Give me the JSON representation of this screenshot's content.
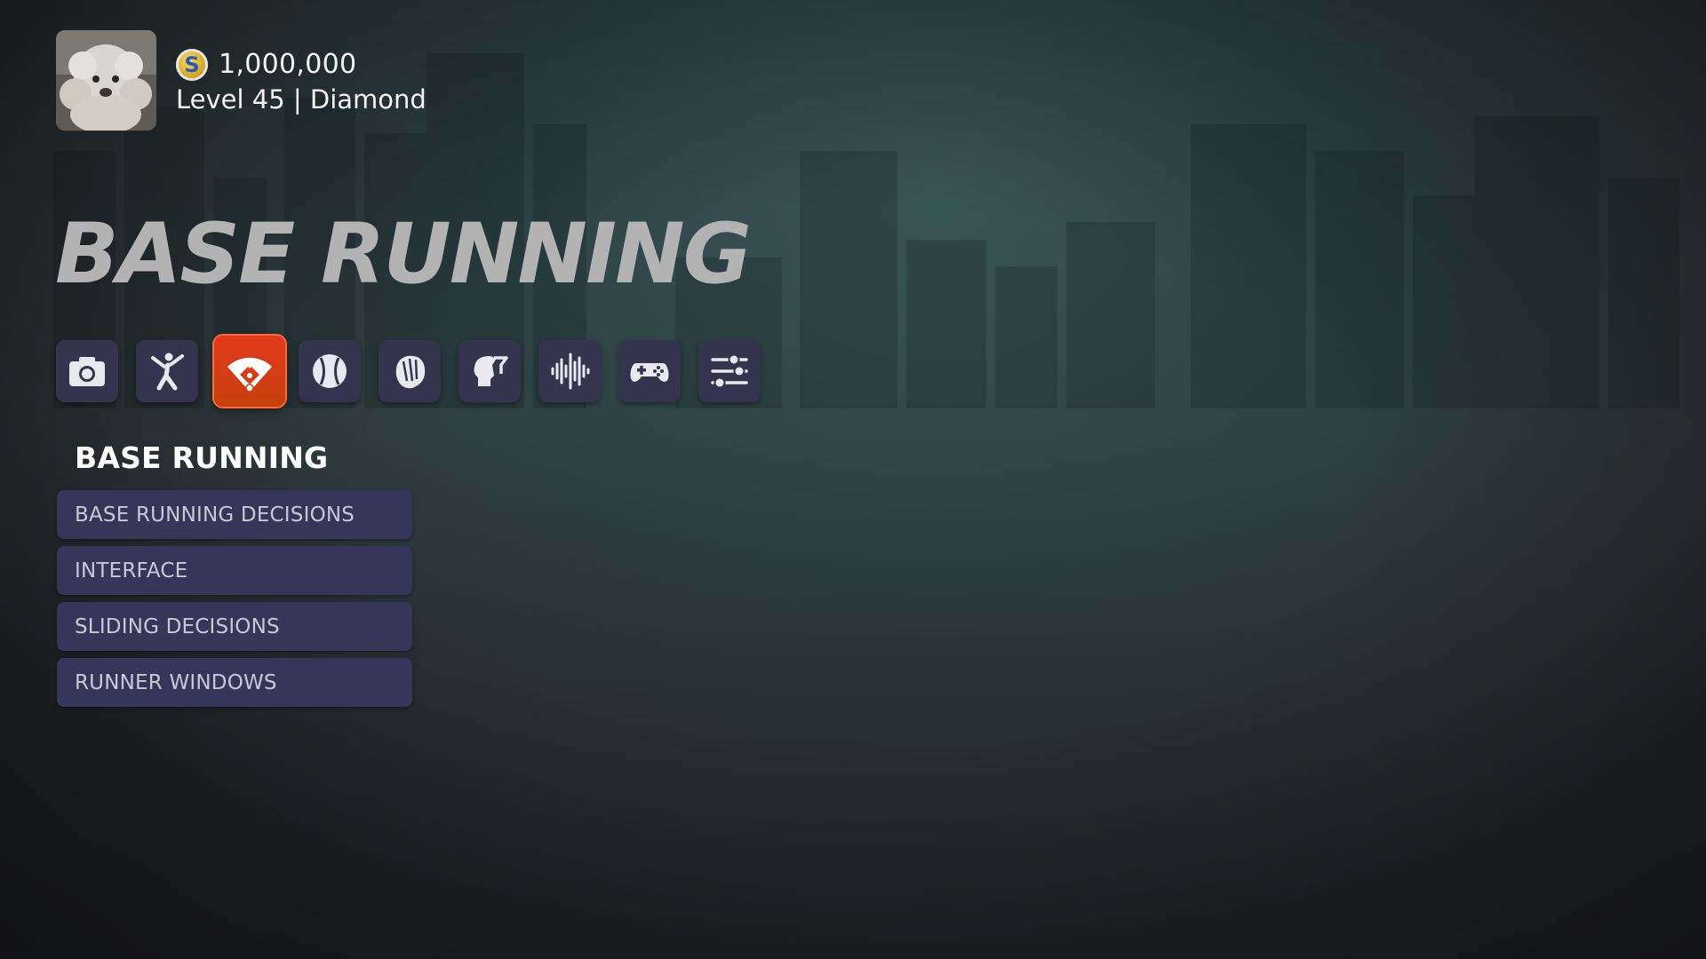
{
  "profile": {
    "avatar_alt": "dog-avatar",
    "coins": "1,000,000",
    "level_line": "Level 45 | Diamond"
  },
  "page": {
    "title": "BASE RUNNING"
  },
  "tabs": [
    {
      "icon": "camera-icon",
      "active": false
    },
    {
      "icon": "batter-icon",
      "active": false
    },
    {
      "icon": "baseball-diamond-icon",
      "active": true
    },
    {
      "icon": "baseball-icon",
      "active": false
    },
    {
      "icon": "glove-icon",
      "active": false
    },
    {
      "icon": "strategy-head-icon",
      "active": false
    },
    {
      "icon": "audio-waveform-icon",
      "active": false
    },
    {
      "icon": "gamepad-icon",
      "active": false
    },
    {
      "icon": "sliders-icon",
      "active": false
    }
  ],
  "section": {
    "title": "BASE RUNNING",
    "items": [
      {
        "label": "BASE RUNNING DECISIONS"
      },
      {
        "label": "INTERFACE"
      },
      {
        "label": "SLIDING DECISIONS"
      },
      {
        "label": "RUNNER WINDOWS"
      }
    ]
  },
  "colors": {
    "tab_bg": "#34344f",
    "tab_active": "#d63d14",
    "menu_bg": "#36355a",
    "title_color": "#b3b3b3"
  }
}
